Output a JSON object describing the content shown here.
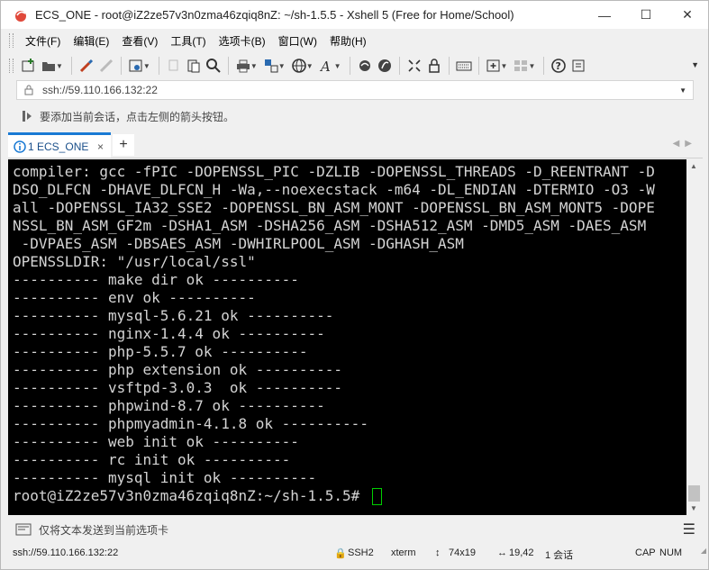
{
  "window": {
    "title": "ECS_ONE - root@iZ2ze57v3n0zma46zqiq8nZ: ~/sh-1.5.5 - Xshell 5 (Free for Home/School)",
    "minimize": "—",
    "maximize": "☐",
    "close": "✕"
  },
  "menu": [
    "文件(F)",
    "编辑(E)",
    "查看(V)",
    "工具(T)",
    "选项卡(B)",
    "窗口(W)",
    "帮助(H)"
  ],
  "address": {
    "value": "ssh://59.110.166.132:22"
  },
  "hint": {
    "text": "要添加当前会话，点击左侧的箭头按钮。"
  },
  "tabs": [
    {
      "label": "1 ECS_ONE",
      "close": "×"
    }
  ],
  "add_tab": "+",
  "terminal": {
    "lines": [
      "compiler: gcc -fPIC -DOPENSSL_PIC -DZLIB -DOPENSSL_THREADS -D_REENTRANT -D",
      "DSO_DLFCN -DHAVE_DLFCN_H -Wa,--noexecstack -m64 -DL_ENDIAN -DTERMIO -O3 -W",
      "all -DOPENSSL_IA32_SSE2 -DOPENSSL_BN_ASM_MONT -DOPENSSL_BN_ASM_MONT5 -DOPE",
      "NSSL_BN_ASM_GF2m -DSHA1_ASM -DSHA256_ASM -DSHA512_ASM -DMD5_ASM -DAES_ASM",
      " -DVPAES_ASM -DBSAES_ASM -DWHIRLPOOL_ASM -DGHASH_ASM",
      "OPENSSLDIR: \"/usr/local/ssl\"",
      "---------- make dir ok ----------",
      "---------- env ok ----------",
      "---------- mysql-5.6.21 ok ----------",
      "---------- nginx-1.4.4 ok ----------",
      "---------- php-5.5.7 ok ----------",
      "---------- php extension ok ----------",
      "---------- vsftpd-3.0.3  ok ----------",
      "---------- phpwind-8.7 ok ----------",
      "---------- phpmyadmin-4.1.8 ok ----------",
      "---------- web init ok ----------",
      "---------- rc init ok ----------",
      "---------- mysql init ok ----------",
      "root@iZ2ze57v3n0zma46zqiq8nZ:~/sh-1.5.5# "
    ],
    "cursor_color": "#00d000"
  },
  "send_bar": {
    "text": "仅将文本发送到当前选项卡"
  },
  "status": {
    "connection": "ssh://59.110.166.132:22",
    "protocol": "SSH2",
    "term": "xterm",
    "size": "74x19",
    "position": "19,42",
    "sessions": "1 会话",
    "caps": "CAP",
    "num": "NUM"
  },
  "colors": {
    "accent": "#1a7ad4",
    "terminal_bg": "#000000",
    "terminal_fg": "#d4d4d4"
  }
}
